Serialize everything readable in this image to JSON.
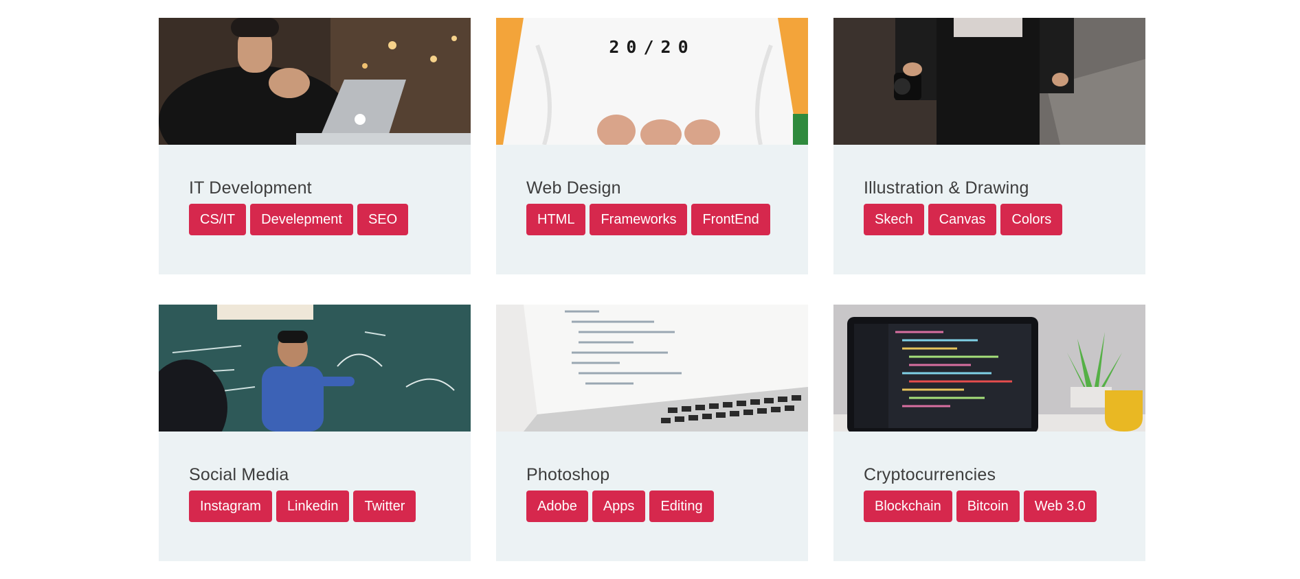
{
  "cards": [
    {
      "title": "IT Development",
      "image_icon": "laptop-man-photo",
      "tags": [
        "CS/IT",
        "Develepment",
        "SEO"
      ]
    },
    {
      "title": "Web Design",
      "image_icon": "tshirt-photo",
      "shirt_text": "20/20",
      "tags": [
        "HTML",
        "Frameworks",
        "FrontEnd"
      ]
    },
    {
      "title": "Illustration & Drawing",
      "image_icon": "camera-person-photo",
      "tags": [
        "Skech",
        "Canvas",
        "Colors"
      ]
    },
    {
      "title": "Social Media",
      "image_icon": "chalkboard-teacher-photo",
      "tags": [
        "Instagram",
        "Linkedin",
        "Twitter"
      ]
    },
    {
      "title": "Photoshop",
      "image_icon": "laptop-code-photo",
      "tags": [
        "Adobe",
        "Apps",
        "Editing"
      ]
    },
    {
      "title": "Cryptocurrencies",
      "image_icon": "code-editor-laptop-photo",
      "tags": [
        "Blockchain",
        "Bitcoin",
        "Web 3.0"
      ]
    }
  ],
  "colors": {
    "card_bg": "#ecf2f4",
    "tag_bg": "#d6284d",
    "tag_text": "#ffffff",
    "title_text": "#3d3d3d"
  }
}
